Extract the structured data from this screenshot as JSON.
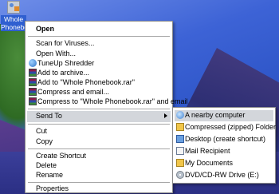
{
  "desktop": {
    "icon_label": "Whole Phonebook"
  },
  "context_menu": {
    "items": [
      {
        "label": "Open"
      },
      {
        "label": "Scan for Viruses..."
      },
      {
        "label": "Open With..."
      },
      {
        "label": "TuneUp Shredder"
      },
      {
        "label": "Add to archive..."
      },
      {
        "label": "Add to \"Whole Phonebook.rar\""
      },
      {
        "label": "Compress and email..."
      },
      {
        "label": "Compress to \"Whole Phonebook.rar\" and email"
      },
      {
        "label": "Send To"
      },
      {
        "label": "Cut"
      },
      {
        "label": "Copy"
      },
      {
        "label": "Create Shortcut"
      },
      {
        "label": "Delete"
      },
      {
        "label": "Rename"
      },
      {
        "label": "Properties"
      }
    ]
  },
  "send_to_menu": {
    "items": [
      {
        "label": "A nearby computer"
      },
      {
        "label": "Compressed (zipped) Folder"
      },
      {
        "label": "Desktop (create shortcut)"
      },
      {
        "label": "Mail Recipient"
      },
      {
        "label": "My Documents"
      },
      {
        "label": "DVD/CD-RW Drive (E:)"
      }
    ]
  },
  "icons": {
    "file": "archive-file-icon",
    "shredder": "shredder-icon",
    "rar": "winrar-icon",
    "network": "nearby-computer-icon",
    "zip": "zip-folder-icon",
    "desktop": "desktop-icon",
    "mail": "mail-icon",
    "documents": "my-documents-icon",
    "dvd": "dvd-drive-icon"
  }
}
